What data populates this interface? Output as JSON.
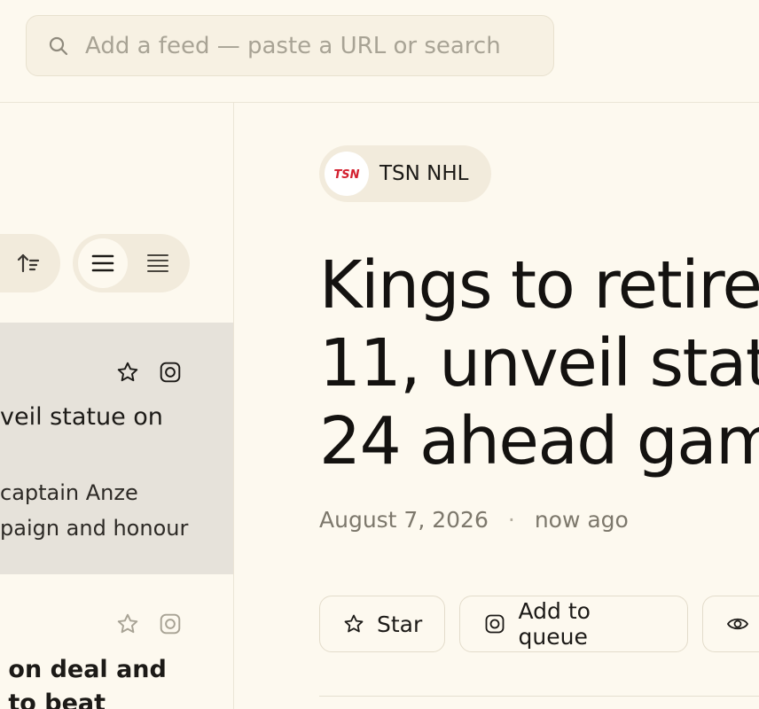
{
  "search": {
    "placeholder": "Add a feed — paste a URL or search"
  },
  "list": {
    "items": [
      {
        "title_lines": [
          "veil statue on"
        ],
        "snippet_lines": [
          "captain Anze",
          "paign and honour"
        ]
      },
      {
        "title_lines": [
          " on deal and",
          " to beat"
        ]
      }
    ]
  },
  "article": {
    "source": {
      "name": "TSN NHL",
      "logo_text": "TSN"
    },
    "headline_lines": [
      "Kings to retire",
      "11, unveil stat",
      "24 ahead gam"
    ],
    "date": "August 7, 2026",
    "separator": "·",
    "relative_time": "now ago",
    "actions": {
      "star": "Star",
      "queue": "Add to queue"
    }
  },
  "colors": {
    "background": "#fdf9ef",
    "selected_row": "#e6e2da",
    "pill": "#f2ebdc",
    "tsn_red": "#d3202f"
  }
}
